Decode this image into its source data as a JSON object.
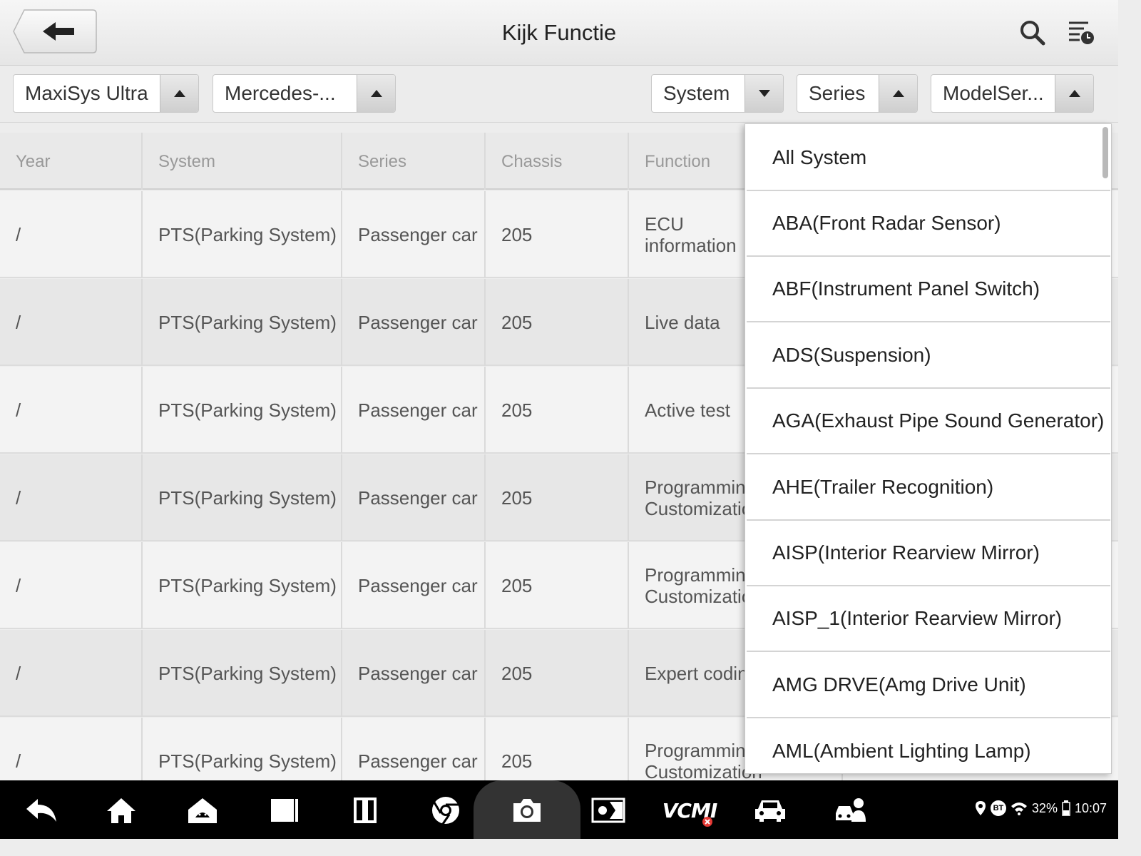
{
  "header": {
    "title": "Kijk Functie"
  },
  "filters": [
    {
      "label": "MaxiSys Ultra",
      "arrow": "up"
    },
    {
      "label": "Mercedes-...",
      "arrow": "up"
    },
    {
      "label": "System",
      "arrow": "down"
    },
    {
      "label": "Series",
      "arrow": "up"
    },
    {
      "label": "ModelSer...",
      "arrow": "up"
    }
  ],
  "table": {
    "columns": [
      "Year",
      "System",
      "Series",
      "Chassis",
      "Function"
    ],
    "rows": [
      {
        "year": "/",
        "system": "PTS(Parking System)",
        "series": "Passenger car",
        "chassis": "205",
        "function": "ECU\ninformation"
      },
      {
        "year": "/",
        "system": "PTS(Parking System)",
        "series": "Passenger car",
        "chassis": "205",
        "function": "Live data"
      },
      {
        "year": "/",
        "system": "PTS(Parking System)",
        "series": "Passenger car",
        "chassis": "205",
        "function": "Active test"
      },
      {
        "year": "/",
        "system": "PTS(Parking System)",
        "series": "Passenger car",
        "chassis": "205",
        "function": "Programming\nCustomization"
      },
      {
        "year": "/",
        "system": "PTS(Parking System)",
        "series": "Passenger car",
        "chassis": "205",
        "function": "Programming\nCustomization"
      },
      {
        "year": "/",
        "system": "PTS(Parking System)",
        "series": "Passenger car",
        "chassis": "205",
        "function": "Expert coding"
      },
      {
        "year": "/",
        "system": "PTS(Parking System)",
        "series": "Passenger car",
        "chassis": "205",
        "function": "Programming\nCustomization"
      }
    ]
  },
  "system_dropdown": {
    "options": [
      "All System",
      "ABA(Front Radar Sensor)",
      "ABF(Instrument Panel Switch)",
      "ADS(Suspension)",
      "AGA(Exhaust Pipe Sound Generator)",
      "AHE(Trailer Recognition)",
      "AISP(Interior Rearview Mirror)",
      "AISP_1(Interior Rearview Mirror)",
      "AMG DRVE(Amg Drive Unit)",
      "AML(Ambient Lighting Lamp)"
    ]
  },
  "navbar": {
    "icons": [
      "back-icon",
      "home-icon",
      "maxisys-home-icon",
      "recent-apps-icon",
      "split-screen-icon",
      "chrome-icon",
      "camera-icon",
      "display-settings-icon",
      "vcm-icon",
      "vehicle-icon",
      "support-icon"
    ],
    "vcm_label": "VCMI",
    "status": {
      "battery": "32%",
      "time": "10:07",
      "bt_label": "BT"
    }
  }
}
